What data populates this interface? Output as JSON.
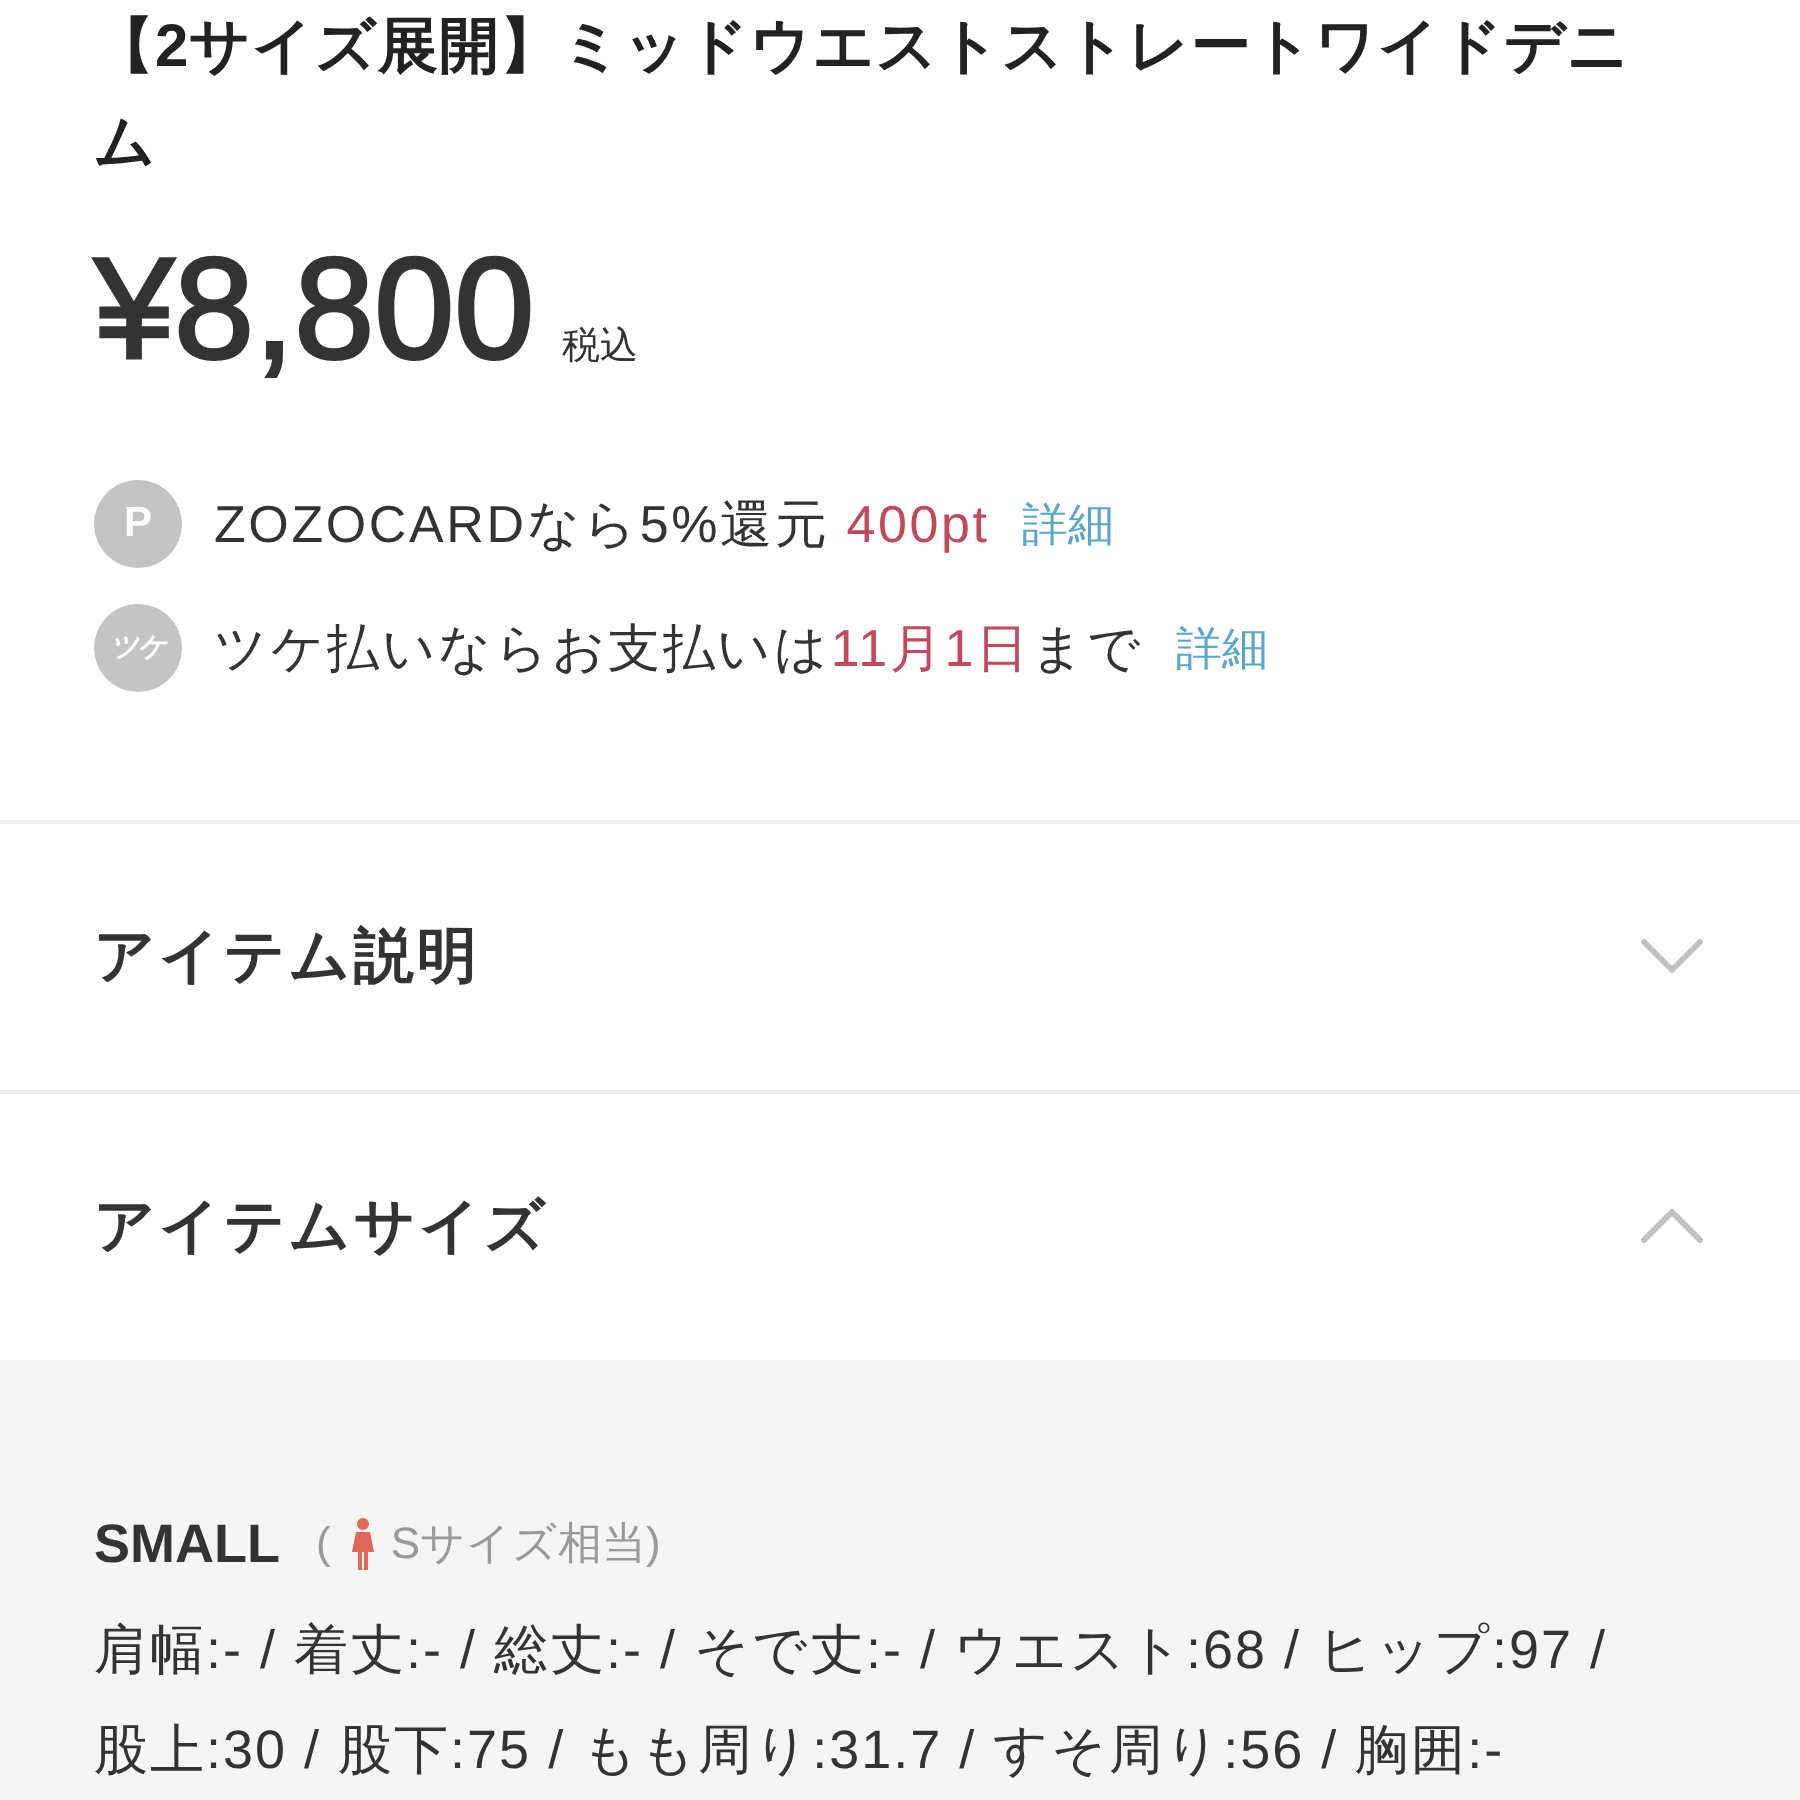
{
  "product": {
    "title": "【2サイズ展開】ミッドウエストストレートワイドデニム",
    "price": "¥8,800",
    "tax_note": "税込"
  },
  "benefits": [
    {
      "badge": "P",
      "segments": [
        {
          "text": "ZOZOCARDなら5%還元 ",
          "highlight": false
        },
        {
          "text": "400pt",
          "highlight": true
        }
      ],
      "link": "詳細"
    },
    {
      "badge": "ツケ",
      "segments": [
        {
          "text": "ツケ払いならお支払いは",
          "highlight": false
        },
        {
          "text": "11月1日",
          "highlight": true
        },
        {
          "text": "まで",
          "highlight": false
        }
      ],
      "link": "詳細"
    }
  ],
  "sections": [
    {
      "title": "アイテム説明",
      "expanded": false
    },
    {
      "title": "アイテムサイズ",
      "expanded": true,
      "sizes": [
        {
          "name": "SMALL",
          "note_open": "(",
          "note": "Sサイズ相当)",
          "measurements": "肩幅:- / 着丈:- / 総丈:- / そで丈:- / ウエスト:68 / ヒップ:97 / 股上:30 / 股下:75 / もも周り:31.7 / すそ周り:56 / 胸囲:-"
        }
      ]
    }
  ]
}
